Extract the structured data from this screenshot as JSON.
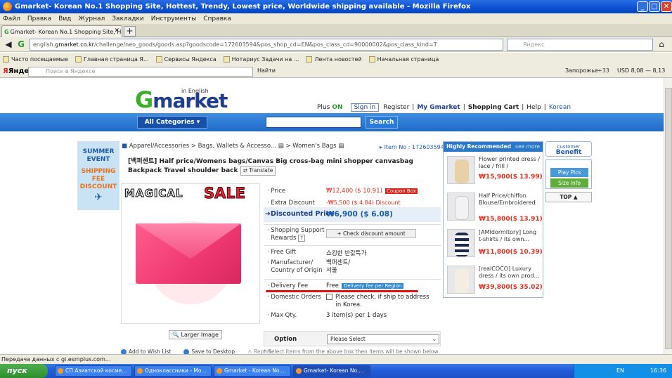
{
  "window": {
    "title": "Gmarket- Korean No.1 Shopping Site, Hottest, Trendy, Lowest price, Worldwide shipping available - Mozilla Firefox",
    "min": "_",
    "max": "□",
    "close": "✕"
  },
  "menu": [
    "Файл",
    "Правка",
    "Вид",
    "Журнал",
    "Закладки",
    "Инструменты",
    "Справка"
  ],
  "tab": {
    "label": "Gmarket- Korean No.1 Shopping Site, Hottes...",
    "new": "+"
  },
  "nav": {
    "url_prefix": "english.",
    "url_domain": "gmarket.co.kr",
    "url_rest": "/challenge/neo_goods/goods.asp?goodscode=172603594&pos_shop_cd=EN&pos_class_cd=90000002&pos_class_kind=T",
    "search_placeholder": "Яндекс"
  },
  "bookmarks": [
    "Часто посещаемые",
    "Главная страница Я...",
    "Сервисы Яндекса",
    "Нотариус Задачи на ...",
    "Лента новостей",
    "Начальная страница"
  ],
  "yandex_bar": {
    "logo": "Яндекс",
    "search_placeholder": "Поиск в Яндексе",
    "find": "Найти",
    "location": "Запорожье",
    "temp": "+33",
    "usd": "USD 8,08 — 8,13"
  },
  "header": {
    "logo_g": "G",
    "logo_rest": "market",
    "logo_sub": "in English",
    "plus": "Plus",
    "plus_state": "ON",
    "signin": "Sign in",
    "register": "Register",
    "mygmarket": "My Gmarket",
    "cart": "Shopping Cart",
    "help": "Help",
    "korean": "Korean",
    "all_categories": "All Categories",
    "search_btn": "Search"
  },
  "banner": {
    "line1": "SUMMER",
    "line2": "EVENT",
    "line3": "SHIPPING",
    "line4": "FEE",
    "line5": "DISCOUNT"
  },
  "product": {
    "breadcrumb": "Apparel/Accessories > Bags, Wallets & Accesso...",
    "breadcrumb_tail": "> Women's Bags",
    "item_no": "Item No : 172603594",
    "title": "[백퍼센트] Half price/Womens bags/Canvas Big cross-bag mini shopper canvasbag Backpack Travel shoulder back",
    "translate": "Translate",
    "img_magical": "MAGICAL",
    "img_sale": "SALE",
    "larger_image": "Larger Image",
    "add_wish": "Add to Wish List",
    "save_desktop": "Save to Desktop",
    "report": "Report"
  },
  "info": {
    "price_label": "Price",
    "price": "₩12,400 ($ 10.91)",
    "coupon": "Coupon Box",
    "extra_label": "Extra Discount",
    "extra": "-₩5,500 ($ 4.84) Discount",
    "disc_label": "Discounted Price",
    "disc": "₩6,900 ($ 6.08)",
    "support_label1": "Shopping Support",
    "support_label2": "Rewards",
    "check_disc": "Check discount amount",
    "gift_label": "Free Gift",
    "gift": "쇼킹한 반값특가",
    "mfr_label1": "Manufacturer/",
    "mfr_label2": "Country of Origin",
    "mfr1": "백퍼센트/",
    "mfr2": "서울",
    "delivery_label": "Delivery Fee",
    "delivery": "Free",
    "delivery_btn": "Delivery fee per Region",
    "domestic_label": "Domestic Orders",
    "domestic1": "Please check, if ship to address",
    "domestic2": "in Korea.",
    "maxqty_label": "Max Qty.",
    "maxqty": "3 item(s) per 1 days",
    "option_label": "Option",
    "option_select": "Please Select",
    "option_note": "* Select items from the above box then items will be shown below."
  },
  "recommended": {
    "heading": "Highly Recommended",
    "more": "see more",
    "items": [
      {
        "name": "Flower printed dress / lace / frill /",
        "price": "₩15,900($ 13.99)"
      },
      {
        "name": "Half Price/chiffon Blouse/Embroidered",
        "price": "₩15,800($ 13.91)"
      },
      {
        "name": "[AMIdormitory] Long t-shirts / its own...",
        "price": "₩11,800($ 10.39)"
      },
      {
        "name": "[realCOCO] Luxury dress / its own prod...",
        "price": "₩39,800($ 35.02)"
      }
    ]
  },
  "side": {
    "benefit1": "customer",
    "benefit2": "Benefit",
    "play": "Play Pics",
    "size": "Size Info",
    "top": "TOP ▲"
  },
  "status": "Передача данных с gi.esmplus.com...",
  "taskbar": {
    "start": "пуск",
    "tasks": [
      "СП Азиатской косме...",
      "Одноклассники - Мо...",
      "Gmarket - Korean No....",
      "Gmarket- Korean No...."
    ],
    "lang": "EN",
    "time": "16:36"
  }
}
